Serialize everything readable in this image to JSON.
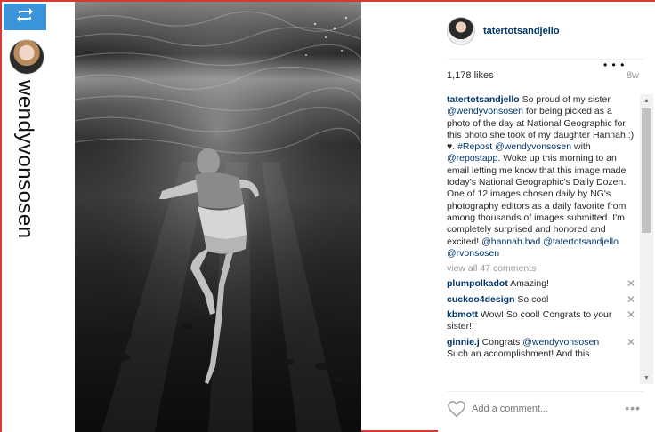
{
  "repost": {
    "username": "wendyvonsosen",
    "badge_icon": "repost-icon",
    "badge_color": "#3b95d9"
  },
  "post": {
    "author": "tatertotsandjello",
    "likes": "1,178 likes",
    "age": "8w",
    "caption": {
      "user": "tatertotsandjello",
      "text_1": " So proud of my sister ",
      "mention_1": "@wendyvonsosen",
      "text_2": " for being picked as a photo of the day at National Geographic for this photo she took of my daughter Hannah :) ♥. ",
      "hashtag": "#Repost",
      "text_3": " ",
      "mention_2": "@wendyvonsosen",
      "text_4": " with ",
      "mention_3": "@repostapp",
      "text_5": ". Woke up this morning to an email letting me know that this image made today's National Geographic's Daily Dozen. One of 12 images chosen daily by NG's photography editors as a daily favorite from among thousands of images submitted. I'm completely surprised and honored and excited! ",
      "mention_4": "@hannah.had",
      "text_6": " ",
      "mention_5": "@tatertotsandjello",
      "text_7": " ",
      "mention_6": "@rvonsosen"
    },
    "view_all": "view all 47 comments",
    "comments": [
      {
        "user": "plumpolkadot",
        "text": " Amazing!"
      },
      {
        "user": "cuckoo4design",
        "text": " So cool"
      },
      {
        "user": "kbmott",
        "text": " Wow! So cool! Congrats to your sister!!"
      },
      {
        "user": "ginnie.j",
        "text": " Congrats ",
        "mention": "@wendyvonsosen",
        "text2": " Such an accomplishment! And this"
      }
    ],
    "remove_glyph": "✕",
    "inline_more": "• • •",
    "add_comment_placeholder": "Add a comment...",
    "more_options": "•••"
  }
}
